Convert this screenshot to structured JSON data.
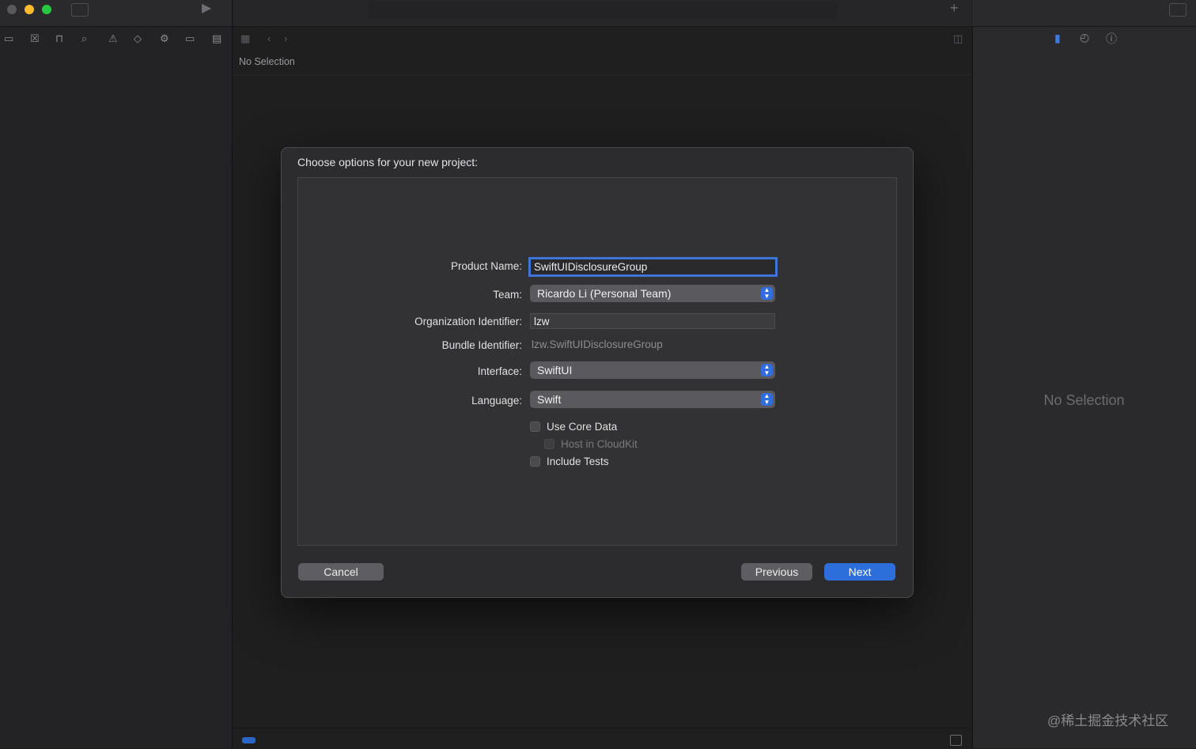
{
  "editor": {
    "no_selection": "No Selection"
  },
  "inspector": {
    "no_selection": "No Selection"
  },
  "dialog": {
    "title": "Choose options for your new project:",
    "fields": {
      "product_name_label": "Product Name:",
      "product_name_value": "SwiftUIDisclosureGroup",
      "team_label": "Team:",
      "team_value": "Ricardo Li (Personal Team)",
      "org_label": "Organization Identifier:",
      "org_value": "lzw",
      "bundle_label": "Bundle Identifier:",
      "bundle_value": "lzw.SwiftUIDisclosureGroup",
      "interface_label": "Interface:",
      "interface_value": "SwiftUI",
      "language_label": "Language:",
      "language_value": "Swift"
    },
    "checkboxes": {
      "core_data": "Use Core Data",
      "cloudkit": "Host in CloudKit",
      "tests": "Include Tests"
    },
    "buttons": {
      "cancel": "Cancel",
      "previous": "Previous",
      "next": "Next"
    }
  },
  "watermark": "@稀土掘金技术社区",
  "icons": {
    "navigator": [
      "folder-icon",
      "source-control-icon",
      "hierarchy-icon",
      "search-icon",
      "warning-icon",
      "test-icon",
      "debug-icon",
      "breakpoint-icon",
      "report-icon"
    ],
    "inspector": [
      "file-icon",
      "history-icon",
      "help-icon"
    ]
  },
  "colors": {
    "accent": "#2c6fdb",
    "close": "#59595b",
    "minimize": "#fdbc2e",
    "maximize": "#28c840"
  }
}
